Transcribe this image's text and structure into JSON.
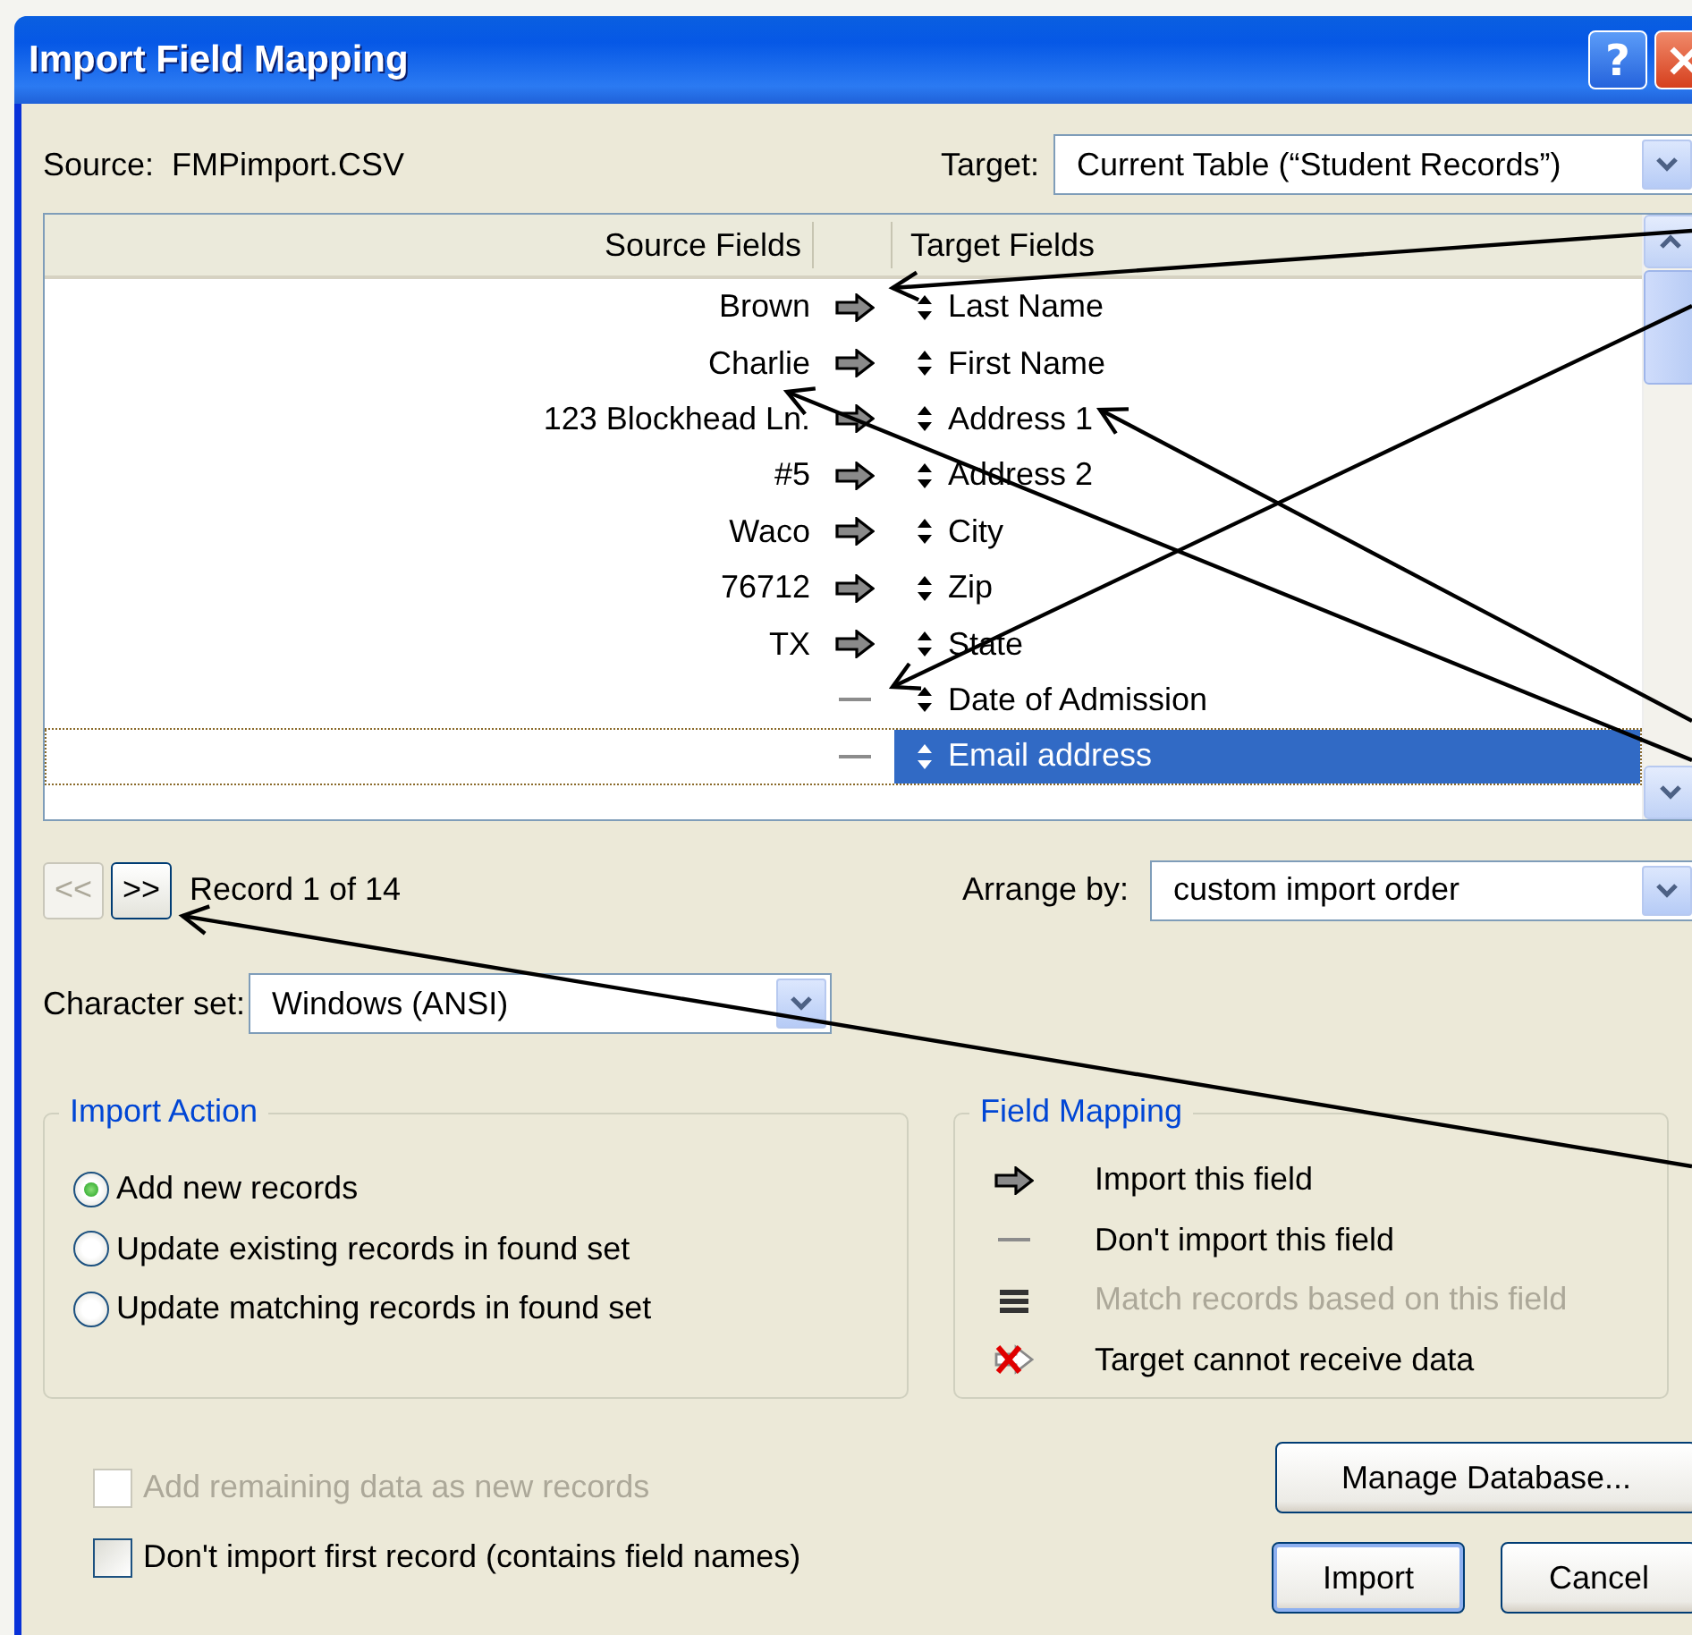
{
  "window": {
    "title": "Import Field Mapping",
    "help_button": "?"
  },
  "source": {
    "label": "Source:",
    "value": "FMPimport.CSV"
  },
  "target": {
    "label": "Target:",
    "value": "Current Table (“Student Records”)"
  },
  "mapping": {
    "columns": [
      "Source Fields",
      "Target Fields"
    ],
    "rows": [
      {
        "source": "Brown",
        "kind": "import",
        "target": "Last Name",
        "selected": false
      },
      {
        "source": "Charlie",
        "kind": "import",
        "target": "First Name",
        "selected": false
      },
      {
        "source": "123 Blockhead Ln.",
        "kind": "import",
        "target": "Address 1",
        "selected": false
      },
      {
        "source": "#5",
        "kind": "import",
        "target": "Address 2",
        "selected": false
      },
      {
        "source": "Waco",
        "kind": "import",
        "target": "City",
        "selected": false
      },
      {
        "source": "76712",
        "kind": "import",
        "target": "Zip",
        "selected": false
      },
      {
        "source": "TX",
        "kind": "import",
        "target": "State",
        "selected": false
      },
      {
        "kind": "skip",
        "target": "Date of Admission",
        "selected": false
      },
      {
        "kind": "skip",
        "target": "Email address",
        "selected": true
      }
    ]
  },
  "navigation": {
    "previous": {
      "label": "<<",
      "disabled": true
    },
    "next": {
      "label": ">>",
      "disabled": false
    },
    "record": "Record 1 of 14"
  },
  "arrange_by": {
    "label": "Arrange by:",
    "value": "custom import order"
  },
  "character_set": {
    "label": "Character set:",
    "value": "Windows (ANSI)"
  },
  "import_action": {
    "title": "Import Action",
    "options": [
      {
        "label": "Add new records",
        "selected": true
      },
      {
        "label": "Update existing records in found set",
        "selected": false
      },
      {
        "label": "Update matching records in found set",
        "selected": false
      }
    ]
  },
  "field_mapping_legend": {
    "title": "Field Mapping",
    "items": [
      {
        "kind": "import",
        "label": "Import this field",
        "disabled": false
      },
      {
        "kind": "skip",
        "label": "Don't import this field",
        "disabled": false
      },
      {
        "kind": "match",
        "label": "Match records based on this field",
        "disabled": true
      },
      {
        "kind": "cannot",
        "label": "Target cannot receive data",
        "disabled": false
      }
    ]
  },
  "options": [
    {
      "label": "Add remaining data as new records",
      "checked": false,
      "disabled": true
    },
    {
      "label": "Don't import first record (contains field names)",
      "checked": false,
      "disabled": false
    }
  ],
  "buttons": [
    {
      "label": "Manage Database...",
      "default": false
    },
    {
      "label": "Import",
      "default": true
    },
    {
      "label": "Cancel",
      "default": false
    }
  ]
}
